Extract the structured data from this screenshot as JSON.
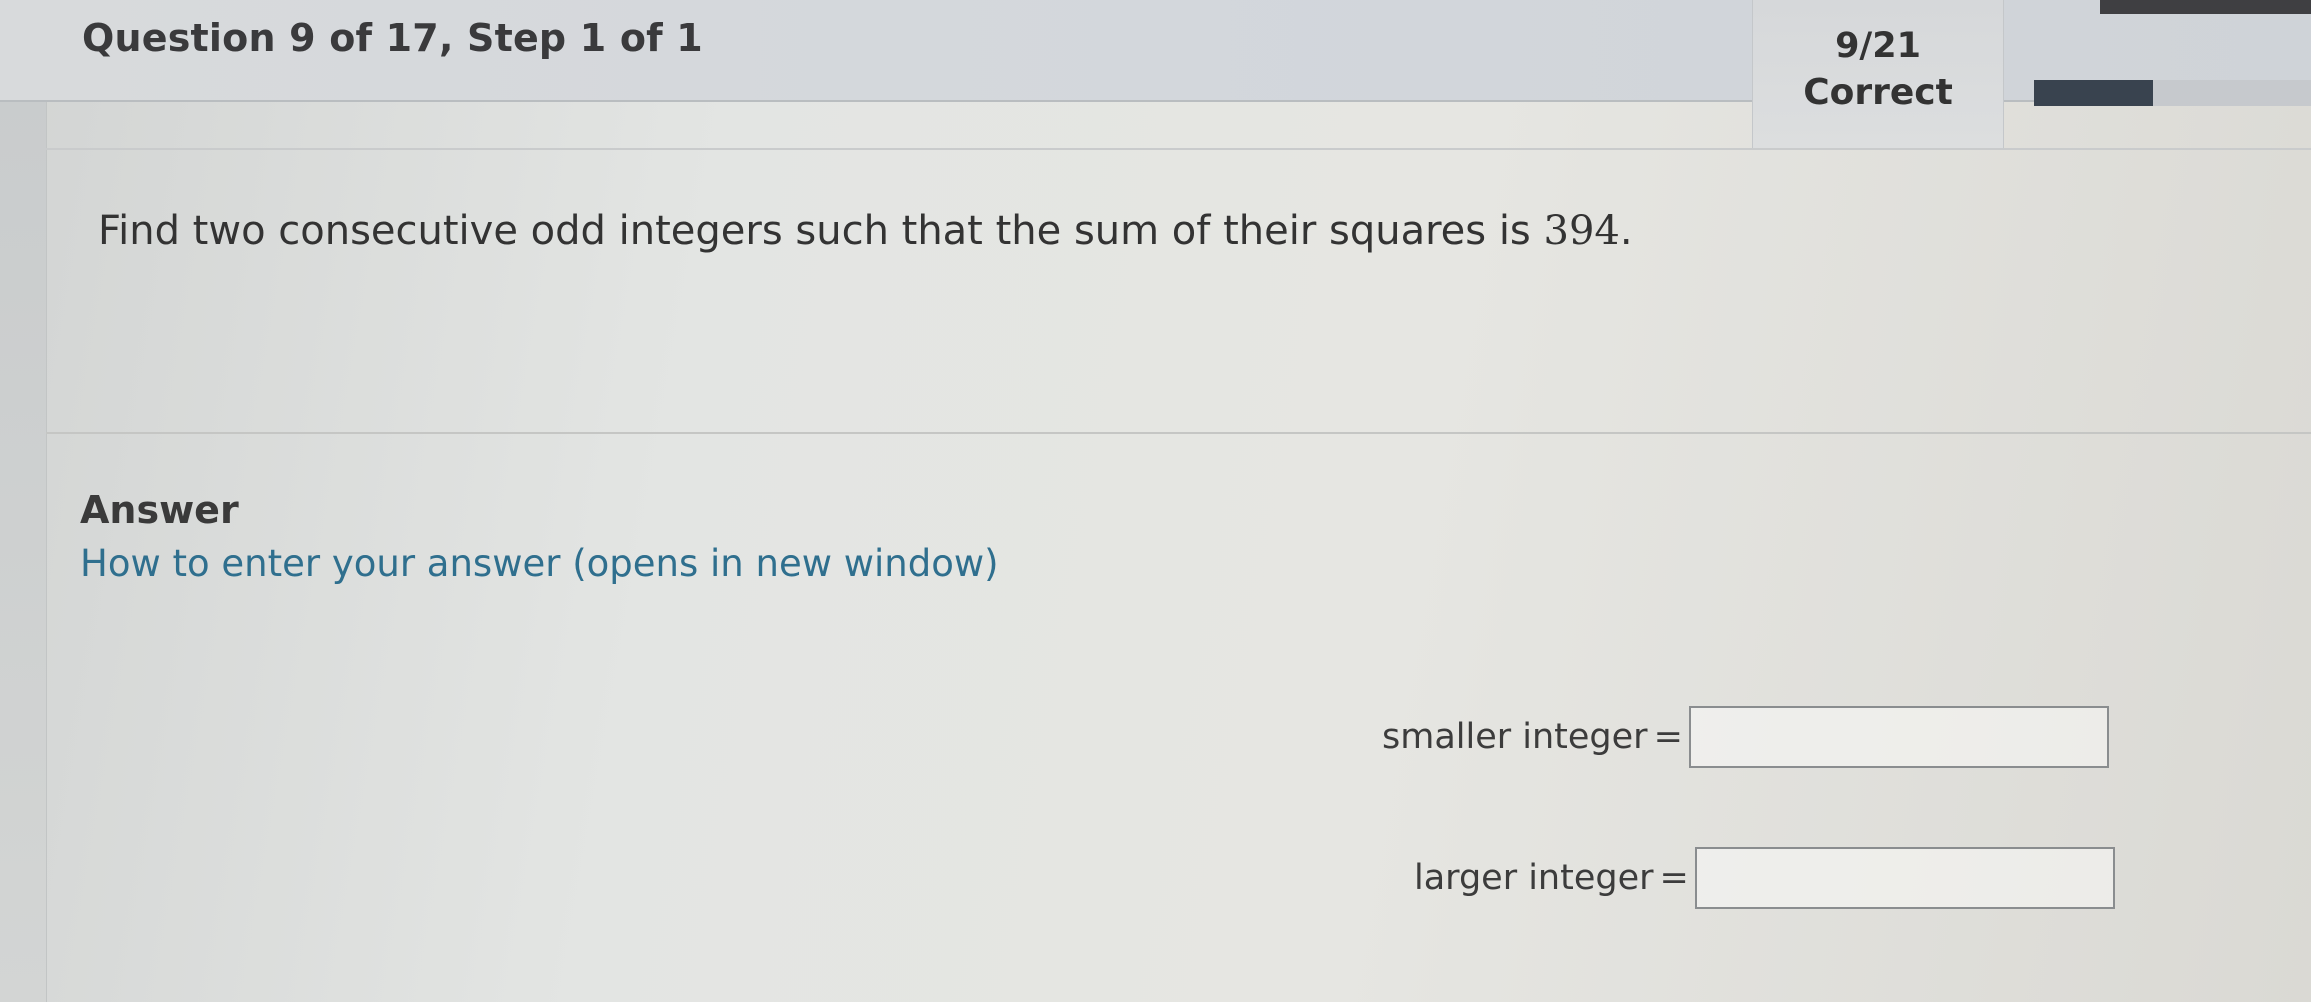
{
  "header": {
    "question_title": "Question 9 of 17, Step 1 of 1",
    "score_count": "9/21",
    "score_status": "Correct"
  },
  "progress": {
    "fraction": 0.43,
    "accent_color": "#39434f"
  },
  "question": {
    "text_prefix": "Find two consecutive odd integers such that the sum of their squares is ",
    "number": "394",
    "text_suffix": "."
  },
  "answer": {
    "heading": "Answer",
    "how_to_link": "How to enter your answer (opens in new window)",
    "fields": [
      {
        "label": "smaller integer",
        "equals": "=",
        "value": ""
      },
      {
        "label": "larger integer",
        "equals": "=",
        "value": ""
      }
    ]
  },
  "colors": {
    "link": "#2f6f8e",
    "text": "#333333"
  }
}
